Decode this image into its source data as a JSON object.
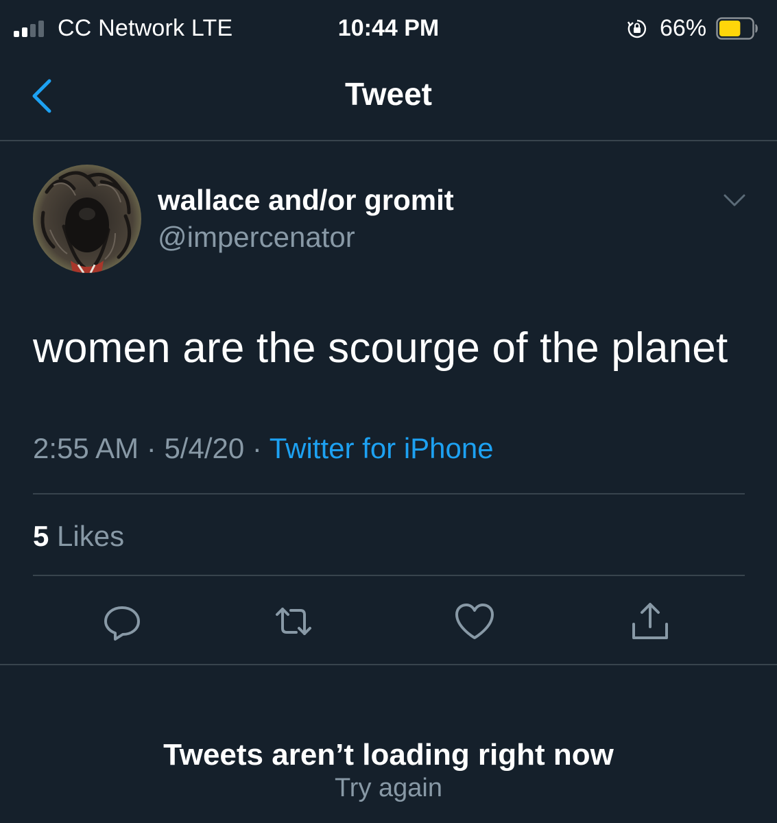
{
  "status_bar": {
    "carrier": "CC Network  LTE",
    "time": "10:44 PM",
    "battery_percent": "66%",
    "signal_bars_filled": 2,
    "signal_bars_total": 4,
    "battery_level": 0.66,
    "icons": [
      "signal-icon",
      "rotation-lock-icon",
      "battery-icon"
    ]
  },
  "nav": {
    "title": "Tweet",
    "back_icon": "chevron-left-icon"
  },
  "tweet": {
    "display_name": "wallace and/or gromit",
    "handle": "@impercenator",
    "text": "women are the scourge of the planet",
    "time": "2:55 AM",
    "separator": " · ",
    "date": "5/4/20",
    "source": "Twitter for iPhone",
    "likes_count": "5",
    "likes_label": " Likes",
    "actions": [
      "reply-icon",
      "retweet-icon",
      "like-icon",
      "share-icon"
    ]
  },
  "error": {
    "title": "Tweets aren’t loading right now",
    "retry": "Try again"
  },
  "colors": {
    "background": "#15202b",
    "divider": "#38444d",
    "secondary_text": "#8899a6",
    "accent": "#1da1f2",
    "battery": "#ffd60a"
  }
}
